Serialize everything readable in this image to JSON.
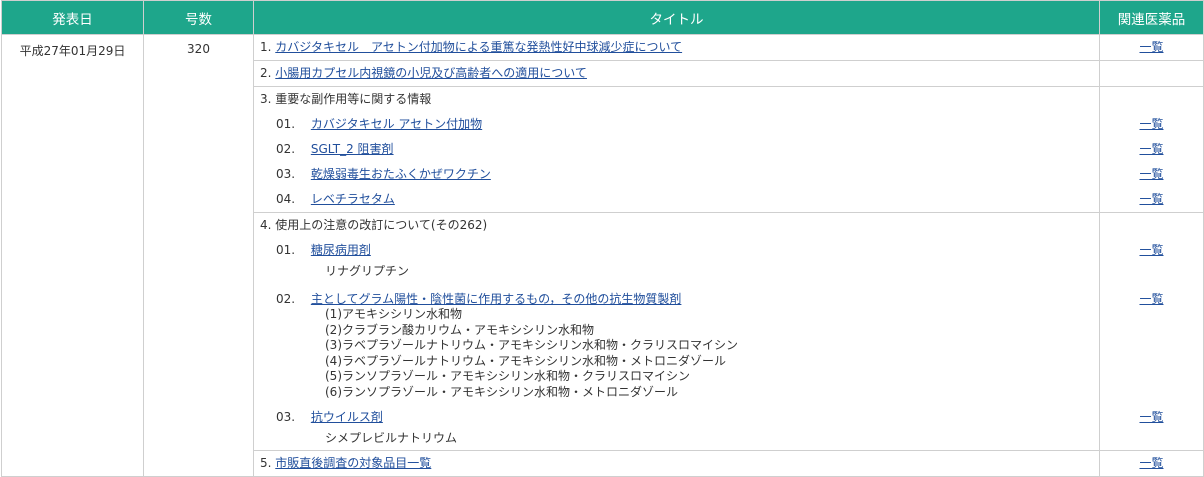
{
  "header": {
    "date": "発表日",
    "number": "号数",
    "title": "タイトル",
    "related": "関連医薬品"
  },
  "record": {
    "date": "平成27年01月29日",
    "number": "320"
  },
  "item1": {
    "no": "1.",
    "title": "カバジタキセル　アセトン付加物による重篤な発熱性好中球減少症について",
    "related": "一覧"
  },
  "item2": {
    "no": "2.",
    "title": "小腸用カプセル内視鏡の小児及び高齢者への適用について"
  },
  "item3": {
    "no": "3.",
    "title": "重要な副作用等に関する情報",
    "subs": [
      {
        "no": "01.",
        "title": "カバジタキセル アセトン付加物",
        "related": "一覧"
      },
      {
        "no": "02.",
        "title": "SGLT_2 阻害剤",
        "related": "一覧"
      },
      {
        "no": "03.",
        "title": "乾燥弱毒生おたふくかぜワクチン",
        "related": "一覧"
      },
      {
        "no": "04.",
        "title": "レベチラセタム",
        "related": "一覧"
      }
    ]
  },
  "item4": {
    "no": "4.",
    "title": "使用上の注意の改訂について(その262)",
    "subs": [
      {
        "no": "01.",
        "title": "糖尿病用剤",
        "drug": "リナグリプチン",
        "related": "一覧"
      },
      {
        "no": "02.",
        "title": "主としてグラム陽性・陰性菌に作用するもの，その他の抗生物質製剤",
        "related": "一覧",
        "drugs": [
          "(1)アモキシシリン水和物",
          "(2)クラブラン酸カリウム・アモキシシリン水和物",
          "(3)ラベプラゾールナトリウム・アモキシシリン水和物・クラリスロマイシン",
          "(4)ラベプラゾールナトリウム・アモキシシリン水和物・メトロニダゾール",
          "(5)ランソプラゾール・アモキシシリン水和物・クラリスロマイシン",
          "(6)ランソプラゾール・アモキシシリン水和物・メトロニダゾール"
        ]
      },
      {
        "no": "03.",
        "title": "抗ウイルス剤",
        "drug": "シメプレビルナトリウム",
        "related": "一覧"
      }
    ]
  },
  "item5": {
    "no": "5.",
    "title": "市販直後調査の対象品目一覧",
    "related": "一覧"
  },
  "colors": {
    "header_bg": "#1ea68b",
    "link": "#214f9c",
    "border": "#cfcfcf"
  }
}
